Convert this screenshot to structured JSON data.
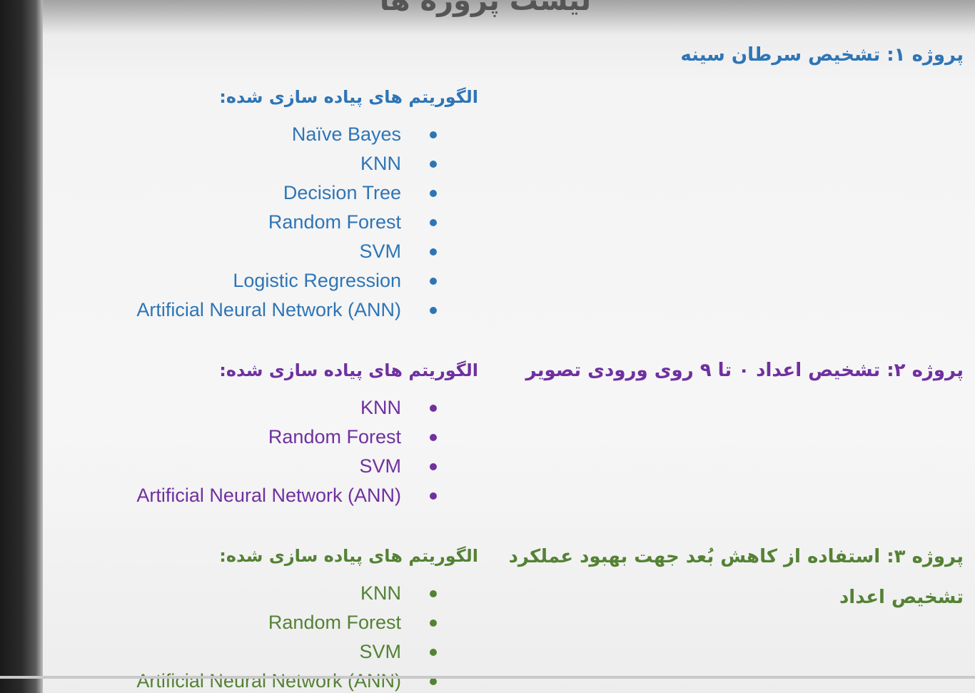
{
  "slide": {
    "title": "لیست پروژه ها"
  },
  "projects": [
    {
      "title": "پروژه ۱: تشخیص سرطان سینه",
      "title_line2": "",
      "algorithms_header": "الگوریتم های پیاده سازی شده:",
      "color": "#2e75b6",
      "algorithms": [
        "Naïve Bayes",
        "KNN",
        "Decision Tree",
        "Random Forest",
        "SVM",
        "Logistic Regression",
        "Artificial Neural Network (ANN)"
      ]
    },
    {
      "title": "پروژه ۲: تشخیص اعداد ۰ تا ۹ روی ورودی تصویر",
      "title_line2": "",
      "algorithms_header": "الگوریتم های پیاده سازی شده:",
      "color": "#7030a0",
      "algorithms": [
        "KNN",
        "Random Forest",
        "SVM",
        "Artificial Neural Network (ANN)"
      ]
    },
    {
      "title": "پروژه ۳: استفاده از کاهش بُعد جهت بهبود عملکرد",
      "title_line2": "تشخیص اعداد",
      "algorithms_header": "الگوریتم های پیاده سازی شده:",
      "color": "#548235",
      "algorithms": [
        "KNN",
        "Random Forest",
        "SVM",
        "Artificial Neural Network (ANN)"
      ]
    }
  ]
}
